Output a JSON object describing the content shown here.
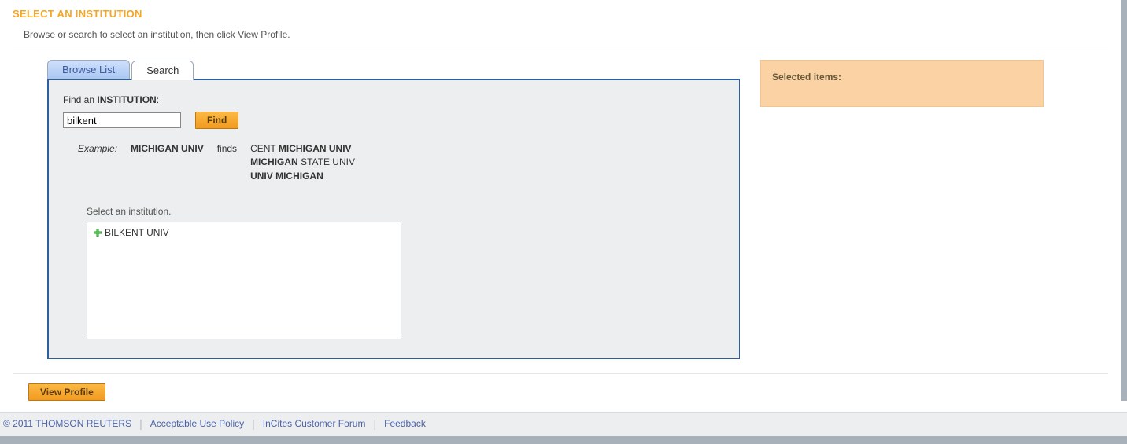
{
  "header": {
    "title": "SELECT AN INSTITUTION",
    "intro": "Browse or search to select an institution, then click View Profile."
  },
  "tabs": {
    "browse": "Browse List",
    "search": "Search"
  },
  "search": {
    "find_label_prefix": "Find an ",
    "find_label_bold": "INSTITUTION",
    "find_label_suffix": ":",
    "input_value": "bilkent",
    "find_button": "Find",
    "example_label": "Example:",
    "example_query": "MICHIGAN UNIV",
    "example_finds": "finds",
    "example_results": {
      "r1_pre": "CENT ",
      "r1_bold": "MICHIGAN UNIV",
      "r2_bold": "MICHIGAN",
      "r2_post": " STATE UNIV",
      "r3_bold": "UNIV MICHIGAN"
    },
    "select_label": "Select an institution.",
    "results": [
      {
        "name": "BILKENT UNIV"
      }
    ]
  },
  "selected_panel": {
    "title": "Selected items:"
  },
  "actions": {
    "view_profile": "View Profile"
  },
  "footer": {
    "copyright": "© 2011 THOMSON REUTERS",
    "links": {
      "aup": "Acceptable Use Policy",
      "forum": "InCites Customer Forum",
      "feedback": "Feedback"
    }
  }
}
